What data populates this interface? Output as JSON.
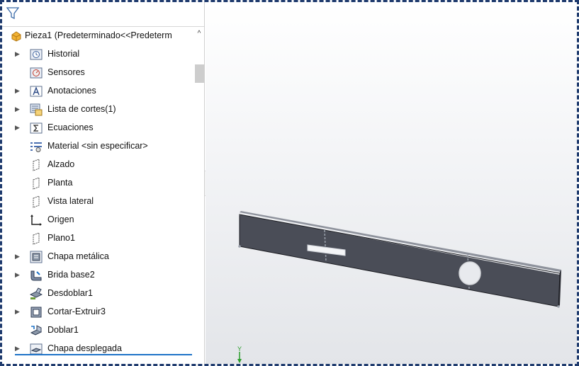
{
  "tree": {
    "root": {
      "label": "Pieza1  (Predeterminado<<Predeterm",
      "icon": "part-icon"
    },
    "items": [
      {
        "label": "Historial",
        "icon": "history-icon",
        "expandable": true
      },
      {
        "label": "Sensores",
        "icon": "sensors-icon",
        "expandable": false
      },
      {
        "label": "Anotaciones",
        "icon": "annotations-icon",
        "expandable": true
      },
      {
        "label": "Lista de cortes(1)",
        "icon": "cut-list-icon",
        "expandable": true
      },
      {
        "label": "Ecuaciones",
        "icon": "equations-icon",
        "expandable": true
      },
      {
        "label": "Material <sin especificar>",
        "icon": "material-icon",
        "expandable": false
      },
      {
        "label": "Alzado",
        "icon": "plane-icon",
        "expandable": false
      },
      {
        "label": "Planta",
        "icon": "plane-icon",
        "expandable": false
      },
      {
        "label": "Vista lateral",
        "icon": "plane-icon",
        "expandable": false
      },
      {
        "label": "Origen",
        "icon": "origin-icon",
        "expandable": false
      },
      {
        "label": "Plano1",
        "icon": "plane-icon",
        "expandable": false
      },
      {
        "label": "Chapa metálica",
        "icon": "sheet-metal-icon",
        "expandable": true
      },
      {
        "label": "Brida base2",
        "icon": "base-flange-icon",
        "expandable": true
      },
      {
        "label": "Desdoblar1",
        "icon": "unfold-icon",
        "expandable": false
      },
      {
        "label": "Cortar-Extruir3",
        "icon": "cut-extrude-icon",
        "expandable": true
      },
      {
        "label": "Doblar1",
        "icon": "fold-icon",
        "expandable": false
      },
      {
        "label": "Chapa desplegada",
        "icon": "flat-pattern-icon",
        "expandable": true
      }
    ]
  },
  "viewport": {
    "triad_label": "Y"
  },
  "colors": {
    "frame": "#1f3b6e",
    "part": "#4a4d57",
    "selection": "#1e73c8"
  }
}
